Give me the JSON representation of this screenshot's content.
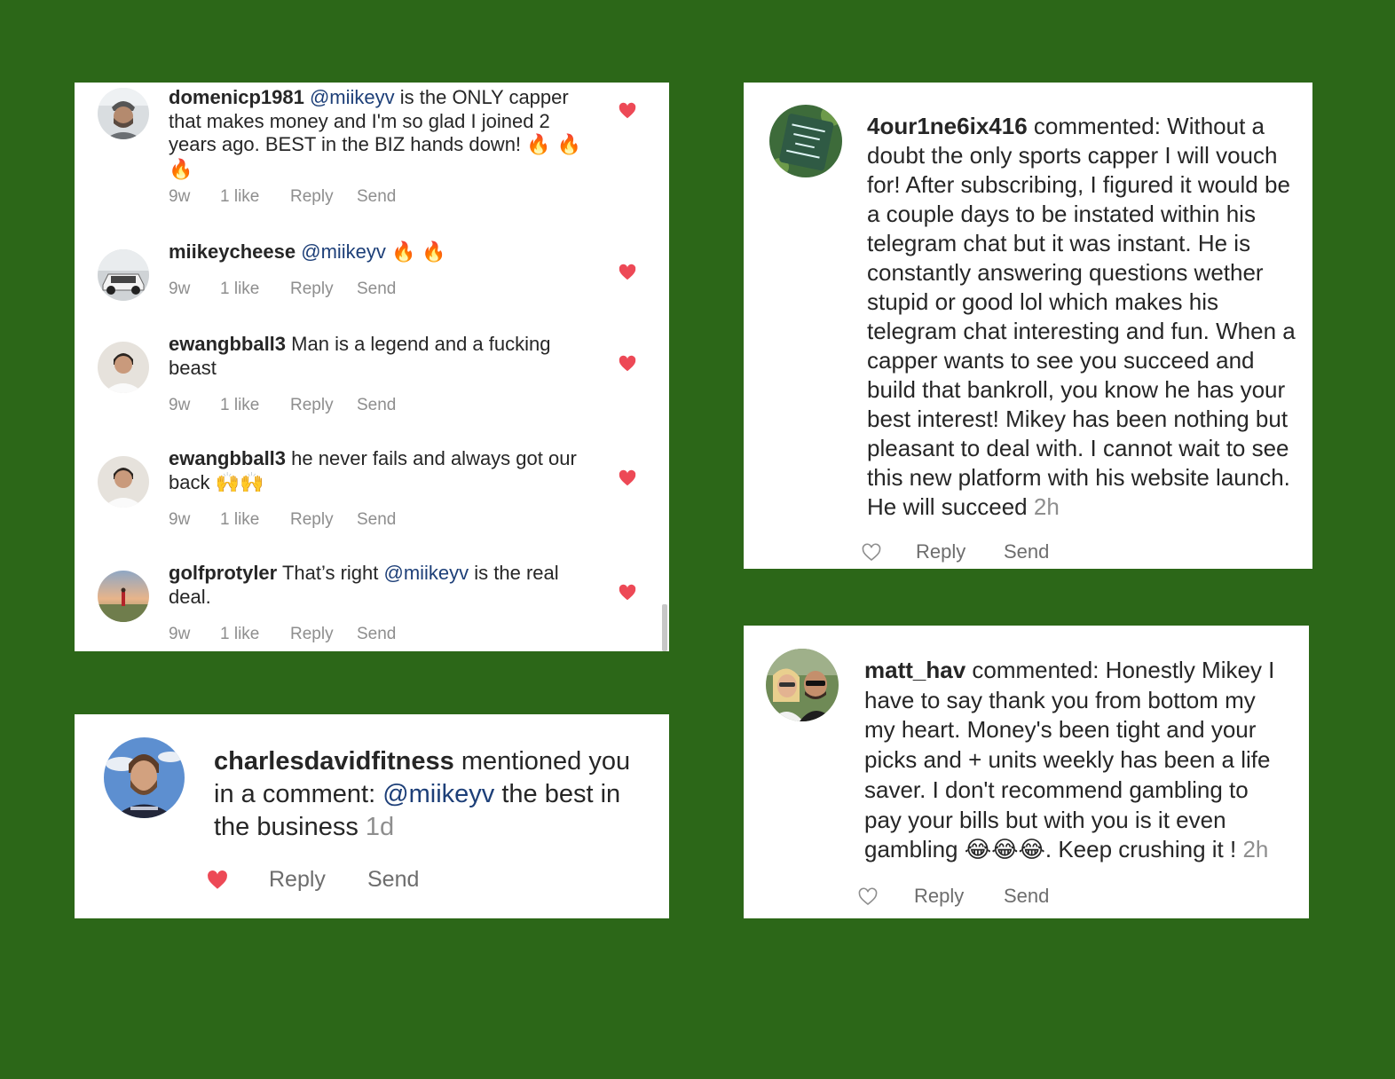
{
  "thread": {
    "comments": [
      {
        "avatar": "man-cap-avatar",
        "username": "domenicp1981",
        "mention": "@miikeyv",
        "text": " is the ONLY capper that makes money and I'm so glad I joined 2 years ago. BEST in the BIZ hands down! ",
        "emoji": "🔥 🔥 🔥",
        "time": "9w",
        "likes": "1 like",
        "reply": "Reply",
        "send": "Send",
        "liked": true
      },
      {
        "avatar": "car-avatar",
        "username": "miikeycheese",
        "mention": "@miikeyv",
        "text": " ",
        "emoji": "🔥 🔥",
        "time": "9w",
        "likes": "1 like",
        "reply": "Reply",
        "send": "Send",
        "liked": true
      },
      {
        "avatar": "person-white-shirt-avatar",
        "username": "ewangbball3",
        "mention": "",
        "text": " Man is a legend and a fucking beast",
        "emoji": "",
        "time": "9w",
        "likes": "1 like",
        "reply": "Reply",
        "send": "Send",
        "liked": true
      },
      {
        "avatar": "person-white-shirt-avatar",
        "username": "ewangbball3",
        "mention": "",
        "text": " he never fails and always got our back ",
        "emoji": "🙌🙌",
        "time": "9w",
        "likes": "1 like",
        "reply": "Reply",
        "send": "Send",
        "liked": true
      },
      {
        "avatar": "golfer-sunset-avatar",
        "username": "golfprotyler",
        "mention": "@miikeyv",
        "pre_text": " That’s right ",
        "text": " is the real deal.",
        "emoji": "",
        "time": "9w",
        "likes": "1 like",
        "reply": "Reply",
        "send": "Send",
        "liked": true
      }
    ]
  },
  "mention_card": {
    "avatar": "bearded-man-avatar",
    "username": "charlesdavidfitness",
    "action": " mentioned you in a comment: ",
    "mention": "@miikeyv",
    "text": " the best in the business ",
    "time": "1d",
    "reply": "Reply",
    "send": "Send",
    "liked": true
  },
  "comment_card_1": {
    "avatar": "neon-sign-avatar",
    "username": "4our1ne6ix416",
    "text": " commented: Without a doubt the only sports capper I will vouch for! After subscribing, I figured it would be a couple days to be instated within his telegram chat but it was instant.  He is constantly answering questions wether stupid or good lol which makes his telegram chat interesting and fun.  When a capper wants to see you succeed and build that bankroll, you know he has your best interest!  Mikey has been nothing but pleasant to deal with.  I cannot wait to see this new platform with his website launch. He will succeed ",
    "time": "2h",
    "reply": "Reply",
    "send": "Send",
    "liked": false
  },
  "comment_card_2": {
    "avatar": "couple-selfie-avatar",
    "username": "matt_hav",
    "text": " commented: Honestly Mikey I have to say thank you from bottom my my heart. Money's been tight and your picks and + units weekly has been a life saver. I don't recommend gambling to pay your bills but with you is it even gambling ",
    "emoji": "😂😂😂",
    "text_after": ". Keep crushing it ! ",
    "time": "2h",
    "reply": "Reply",
    "send": "Send",
    "liked": false
  },
  "colors": {
    "background": "#2c6718",
    "heart": "#ed4956",
    "mention": "#1d3f78",
    "muted": "#8e8e8e"
  }
}
